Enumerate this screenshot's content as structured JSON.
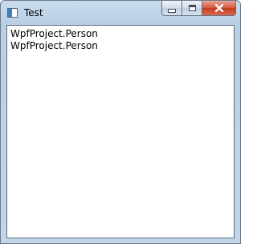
{
  "window": {
    "title": "Test"
  },
  "list": {
    "items": [
      "WpfProject.Person",
      "WpfProject.Person"
    ]
  },
  "icons": {
    "app": "window-app-icon",
    "minimize": "minimize-icon",
    "maximize": "maximize-icon",
    "close": "close-icon"
  },
  "colors": {
    "close_button": "#c83b1f",
    "frame": "#c3d5e9"
  }
}
